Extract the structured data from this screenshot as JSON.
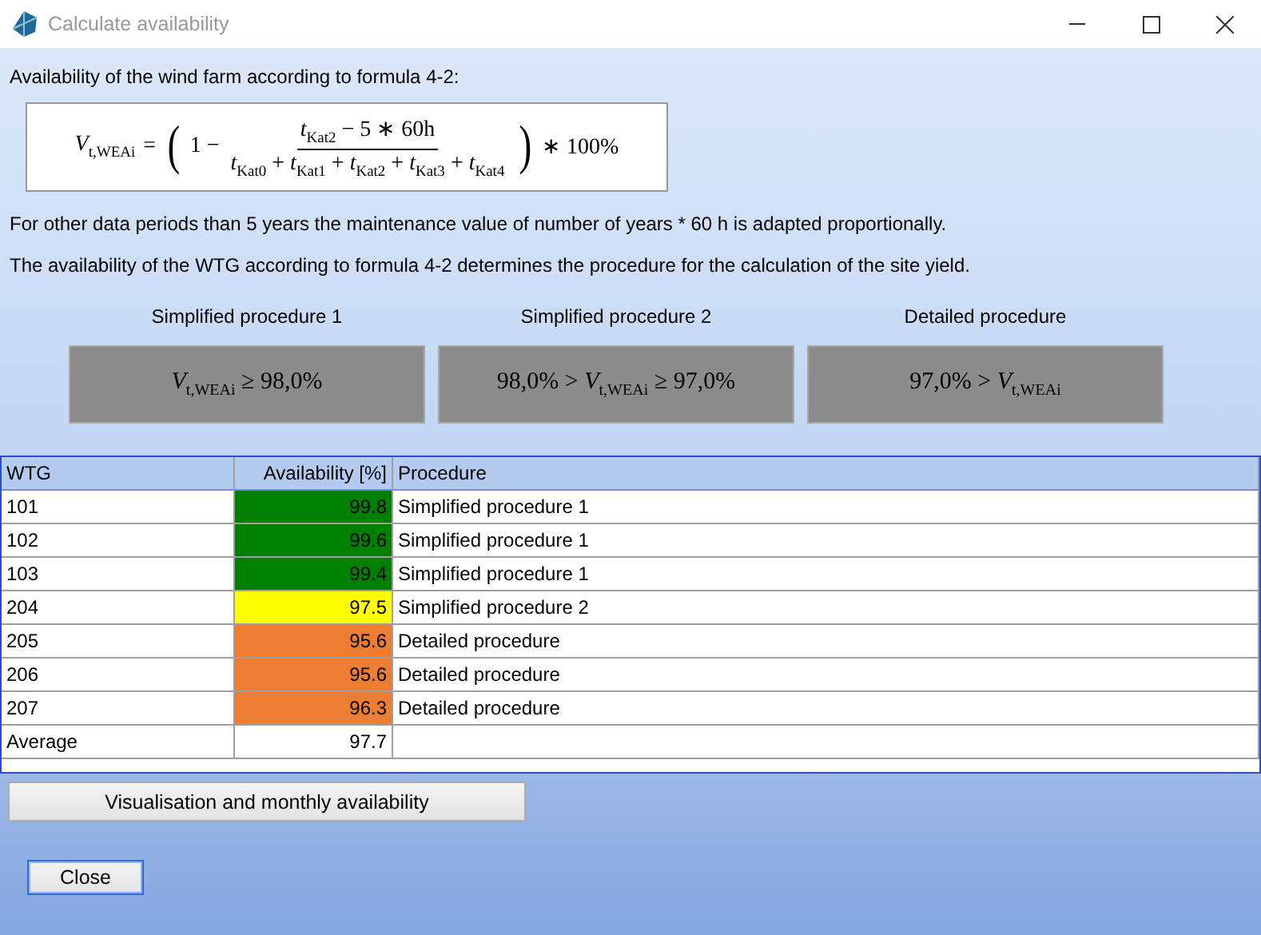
{
  "window": {
    "title": "Calculate availability",
    "controls": [
      {
        "kind": "minimize"
      },
      {
        "kind": "maximize"
      },
      {
        "kind": "close"
      }
    ]
  },
  "intro": "Availability of the wind farm according to formula 4-2:",
  "formula": {
    "lhs": "*V*$_{t,WEAi}$",
    "equals": "=",
    "open": "(",
    "lead": "1 −",
    "numerator": "*t*$_{Kat2}$ − 5 ∗ 60h",
    "denominator": "*t*$_{Kat0}$ + *t*$_{Kat1}$ + *t*$_{Kat2}$ + *t*$_{Kat3}$ + *t*$_{Kat4}$",
    "close": ")",
    "trail": "∗ 100%"
  },
  "notes": [
    "For other data periods than 5 years the maintenance value of number of years * 60 h is adapted proportionally.",
    "The availability of the WTG according to formula 4-2 determines the procedure for the calculation of the site yield."
  ],
  "procedures": [
    {
      "title": "Simplified procedure 1",
      "condition": "*V*$_{t,WEAi}$ ≥ 98,0%"
    },
    {
      "title": "Simplified procedure 2",
      "condition": "98,0% > *V*$_{t,WEAi}$ ≥ 97,0%"
    },
    {
      "title": "Detailed procedure",
      "condition": "97,0% > *V*$_{t,WEAi}$"
    }
  ],
  "table": {
    "columns": [
      "WTG",
      "Availability [%]",
      "Procedure"
    ],
    "rows": [
      {
        "wtg": "101",
        "availability": "99.8",
        "procedure": "Simplified procedure 1",
        "color": "#008000"
      },
      {
        "wtg": "102",
        "availability": "99.6",
        "procedure": "Simplified procedure 1",
        "color": "#008000"
      },
      {
        "wtg": "103",
        "availability": "99.4",
        "procedure": "Simplified procedure 1",
        "color": "#008000"
      },
      {
        "wtg": "204",
        "availability": "97.5",
        "procedure": "Simplified procedure 2",
        "color": "#ffff00"
      },
      {
        "wtg": "205",
        "availability": "95.6",
        "procedure": "Detailed procedure",
        "color": "#ed7d31"
      },
      {
        "wtg": "206",
        "availability": "95.6",
        "procedure": "Detailed procedure",
        "color": "#ed7d31"
      },
      {
        "wtg": "207",
        "availability": "96.3",
        "procedure": "Detailed procedure",
        "color": "#ed7d31"
      }
    ],
    "average": {
      "label": "Average",
      "value": "97.7"
    }
  },
  "buttons": {
    "visualise": "Visualisation and monthly availability",
    "close": "Close"
  }
}
